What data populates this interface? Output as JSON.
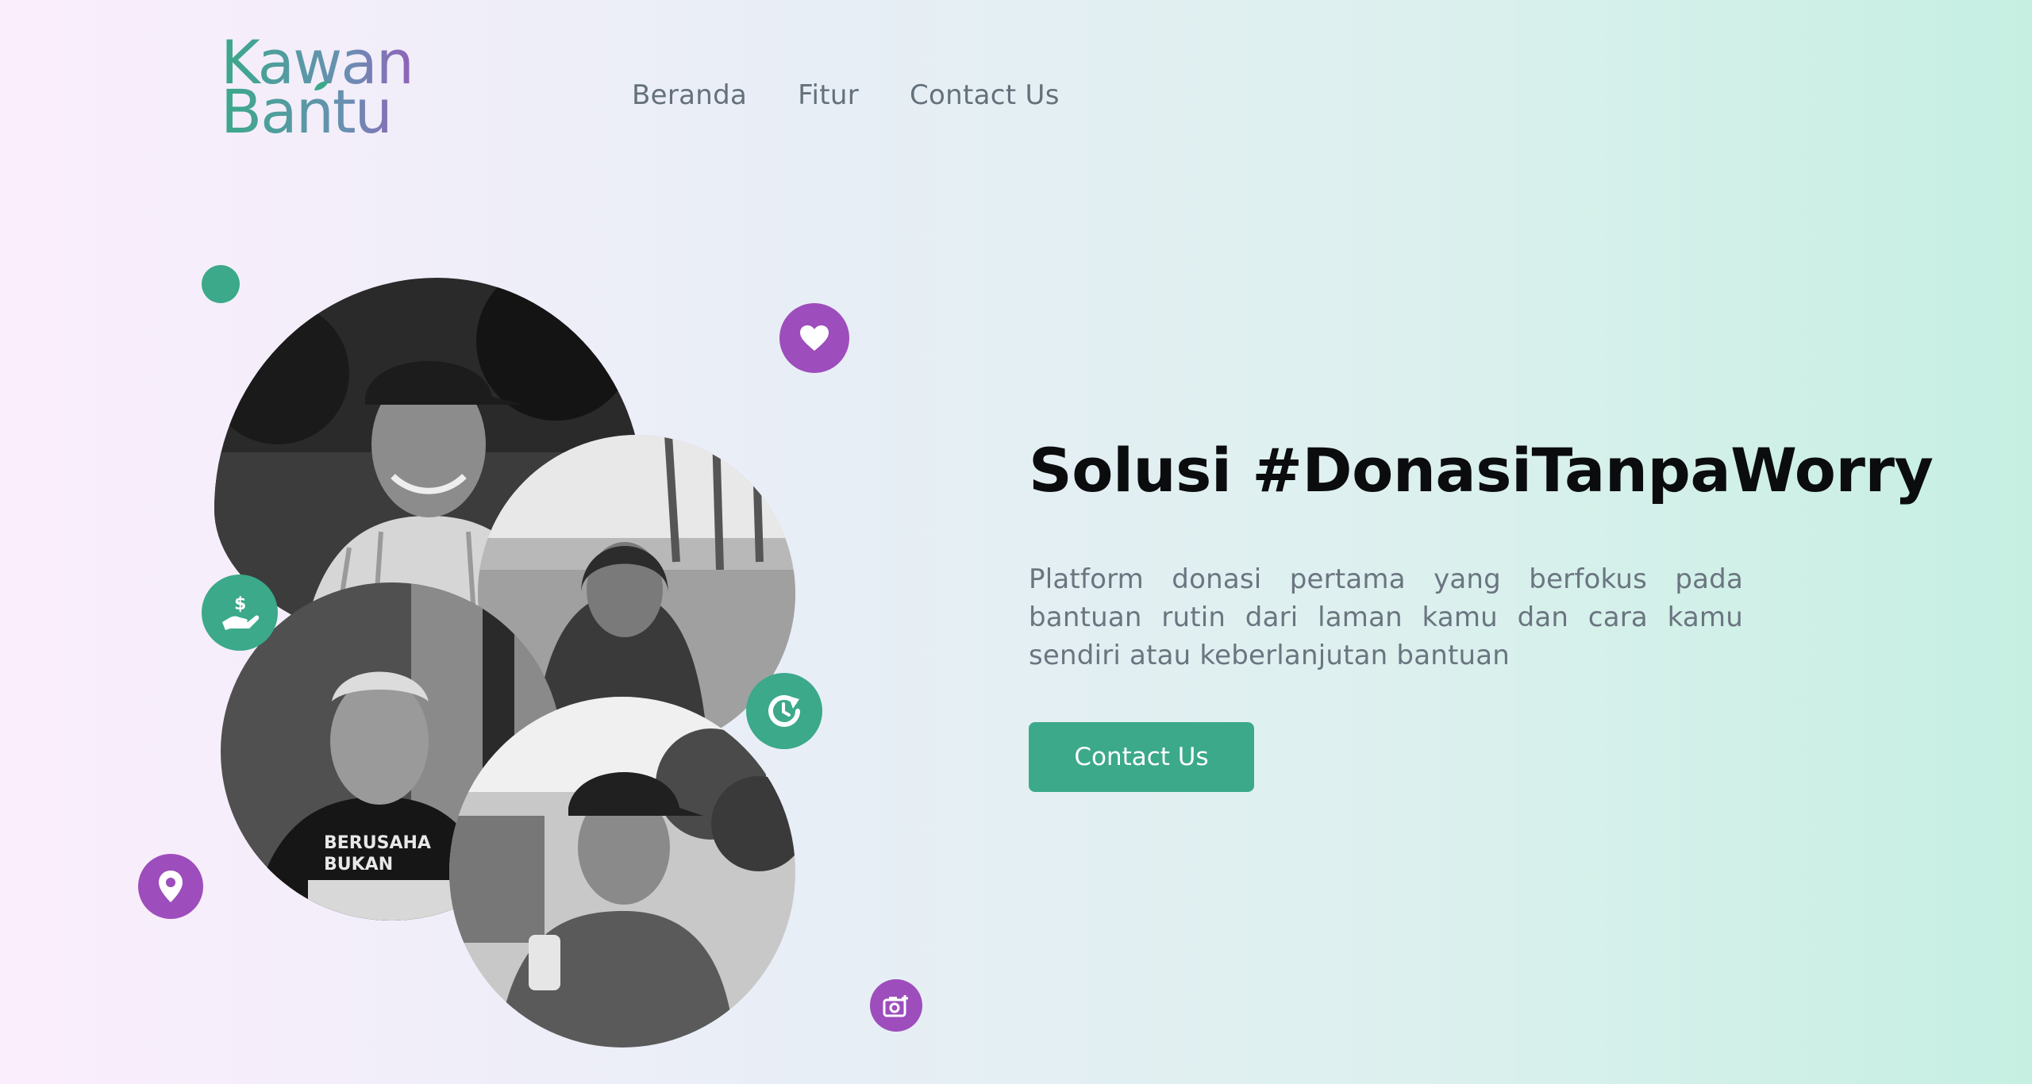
{
  "brand": {
    "line1": "Kawan",
    "line2": "Bantu",
    "colors": {
      "green": "#3ba98a",
      "purple": "#9d4dbc"
    }
  },
  "nav": {
    "items": [
      {
        "label": "Beranda"
      },
      {
        "label": "Fitur"
      },
      {
        "label": "Contact Us"
      }
    ]
  },
  "hero": {
    "title": "Solusi #DonasiTanpaWorry",
    "description": "Platform donasi pertama yang berfokus pada bantuan rutin dari laman kamu dan cara kamu sendiri atau keberlanjutan bantuan",
    "cta_label": "Contact Us",
    "shirt_text": "BERUSAHA BUKAN"
  },
  "icons": {
    "heart": "heart-icon",
    "money": "money-hand-icon",
    "rotate": "rotate-icon",
    "pin": "location-pin-icon",
    "camera": "camera-icon"
  }
}
